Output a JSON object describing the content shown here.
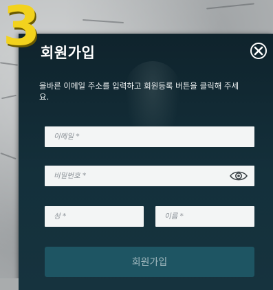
{
  "step_badge": "3",
  "modal": {
    "title": "회원가입",
    "description": "올바른 이메일 주소를 입력하고 회원등록 버튼을 클릭해 주세요.",
    "close_icon": "close-circle-icon"
  },
  "form": {
    "email_placeholder": "이메일 *",
    "password_placeholder": "비밀번호 *",
    "password_toggle_icon": "eye-icon",
    "last_name_placeholder": "성 *",
    "first_name_placeholder": "이름 *",
    "submit_label": "회원가입"
  },
  "colors": {
    "modal_background": "#122832",
    "submit_button": "#1e5563",
    "badge": "#f2d21d"
  }
}
